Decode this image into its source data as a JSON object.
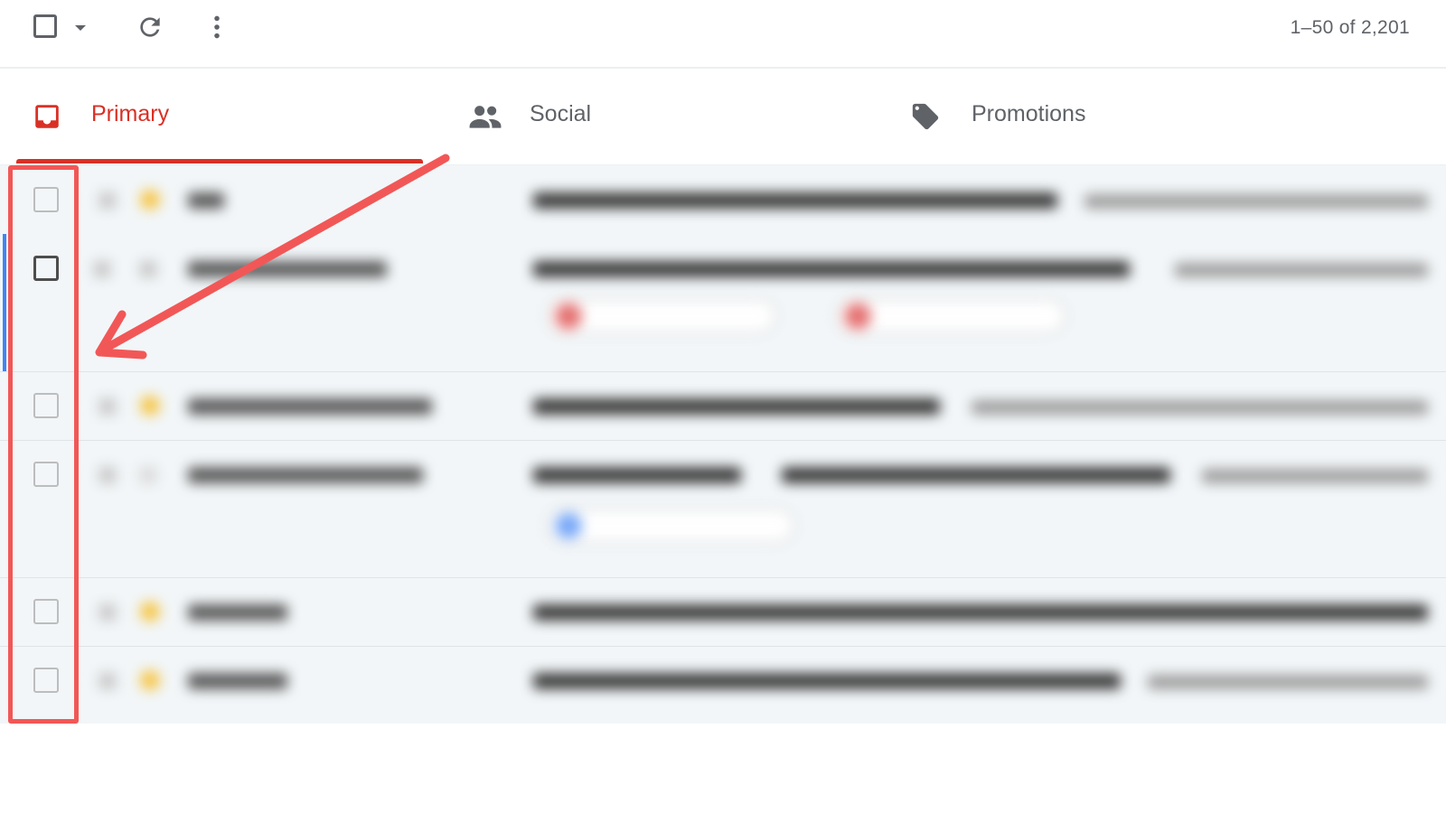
{
  "toolbar": {
    "select_all_icon": "checkbox-icon",
    "select_menu_icon": "caret-down-icon",
    "refresh_icon": "refresh-icon",
    "more_icon": "more-vert-icon",
    "pagination": "1–50 of 2,201"
  },
  "tabs": [
    {
      "label": "Primary",
      "icon": "inbox-icon",
      "selected": true
    },
    {
      "label": "Social",
      "icon": "people-icon",
      "selected": false
    },
    {
      "label": "Promotions",
      "icon": "tag-icon",
      "selected": false
    }
  ],
  "colors": {
    "primary_tab": "#d93025",
    "annotation": "#f25757",
    "focus_bar": "#4285f4",
    "star": "#f6c544"
  },
  "annotation": {
    "type": "arrow-and-box",
    "target": "row-checkboxes"
  }
}
